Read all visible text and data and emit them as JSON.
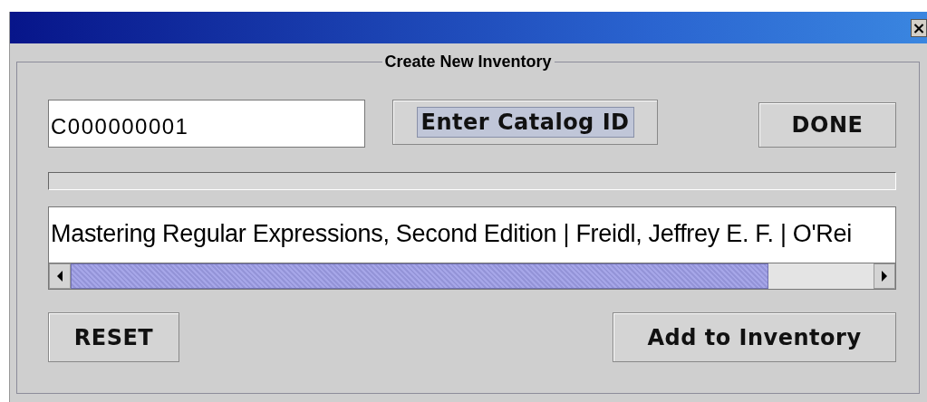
{
  "window": {
    "title_bar": {
      "close": "×"
    }
  },
  "panel": {
    "title": "Create New Inventory"
  },
  "catalog_field": {
    "value": "C000000001"
  },
  "top_buttons": [
    {
      "label": "Enter Catalog ID",
      "focused": true
    },
    {
      "label": "DONE",
      "focused": false
    }
  ],
  "progress": {
    "level": 0
  },
  "result": {
    "text": "Mastering Regular Expressions, Second Edition | Freidl, Jeffrey E. F. | O'Rei"
  },
  "bottom_buttons": [
    {
      "label": "RESET",
      "focused": false
    },
    {
      "label": "Add to Inventory",
      "focused": false
    }
  ]
}
